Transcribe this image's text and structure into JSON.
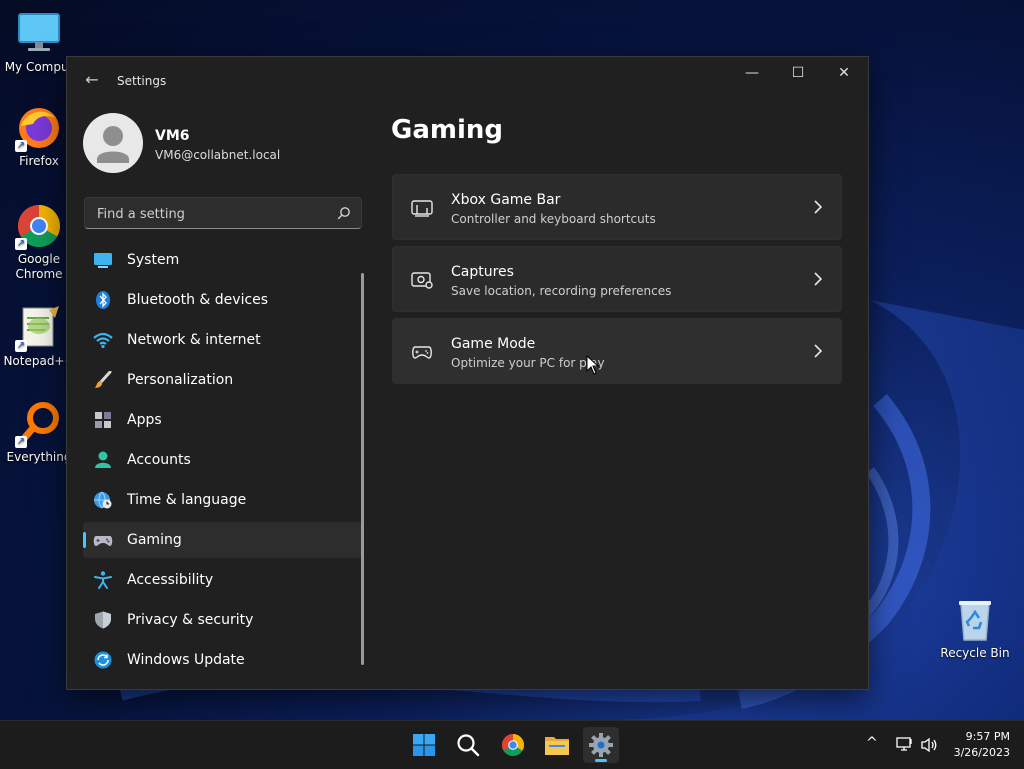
{
  "desktop": {
    "icons": [
      {
        "label": "My Comput",
        "icon": "monitor-icon"
      },
      {
        "label": "Firefox",
        "icon": "firefox-icon"
      },
      {
        "label": "Google Chrome",
        "icon": "chrome-icon"
      },
      {
        "label": "Notepad++",
        "icon": "notepadpp-icon"
      },
      {
        "label": "Everything",
        "icon": "search-magnifier-icon"
      },
      {
        "label": "Recycle Bin",
        "icon": "recycle-bin-icon"
      }
    ],
    "shortcut_glyph": "↗"
  },
  "window": {
    "title": "Settings",
    "controls": {
      "minimize": "—",
      "maximize": "☐",
      "close": "✕"
    },
    "back_glyph": "←"
  },
  "profile": {
    "name": "VM6",
    "email": "VM6@collabnet.local"
  },
  "search": {
    "placeholder": "Find a setting"
  },
  "nav": {
    "items": [
      {
        "label": "System",
        "icon": "system-icon"
      },
      {
        "label": "Bluetooth & devices",
        "icon": "bluetooth-icon"
      },
      {
        "label": "Network & internet",
        "icon": "wifi-icon"
      },
      {
        "label": "Personalization",
        "icon": "brush-icon"
      },
      {
        "label": "Apps",
        "icon": "apps-icon"
      },
      {
        "label": "Accounts",
        "icon": "accounts-icon"
      },
      {
        "label": "Time & language",
        "icon": "globe-clock-icon"
      },
      {
        "label": "Gaming",
        "icon": "gamepad-icon"
      },
      {
        "label": "Accessibility",
        "icon": "accessibility-icon"
      },
      {
        "label": "Privacy & security",
        "icon": "shield-icon"
      },
      {
        "label": "Windows Update",
        "icon": "update-icon"
      }
    ],
    "active": "Gaming"
  },
  "main": {
    "title": "Gaming",
    "cards": [
      {
        "title": "Xbox Game Bar",
        "subtitle": "Controller and keyboard shortcuts",
        "icon": "game-bar-icon"
      },
      {
        "title": "Captures",
        "subtitle": "Save location, recording preferences",
        "icon": "captures-icon"
      },
      {
        "title": "Game Mode",
        "subtitle": "Optimize your PC for play",
        "icon": "game-mode-icon"
      }
    ]
  },
  "taskbar": {
    "apps": [
      "windows-start-icon",
      "search-icon",
      "chrome-icon",
      "file-explorer-icon",
      "settings-gear-icon"
    ],
    "active_app": "settings-gear-icon",
    "tray": {
      "chevron": "^"
    },
    "clock": {
      "time": "9:57 PM",
      "date": "3/26/2023"
    }
  },
  "colors": {
    "accent": "#4cc2ff",
    "window_bg": "#202020",
    "card_bg": "#2b2b2b"
  }
}
